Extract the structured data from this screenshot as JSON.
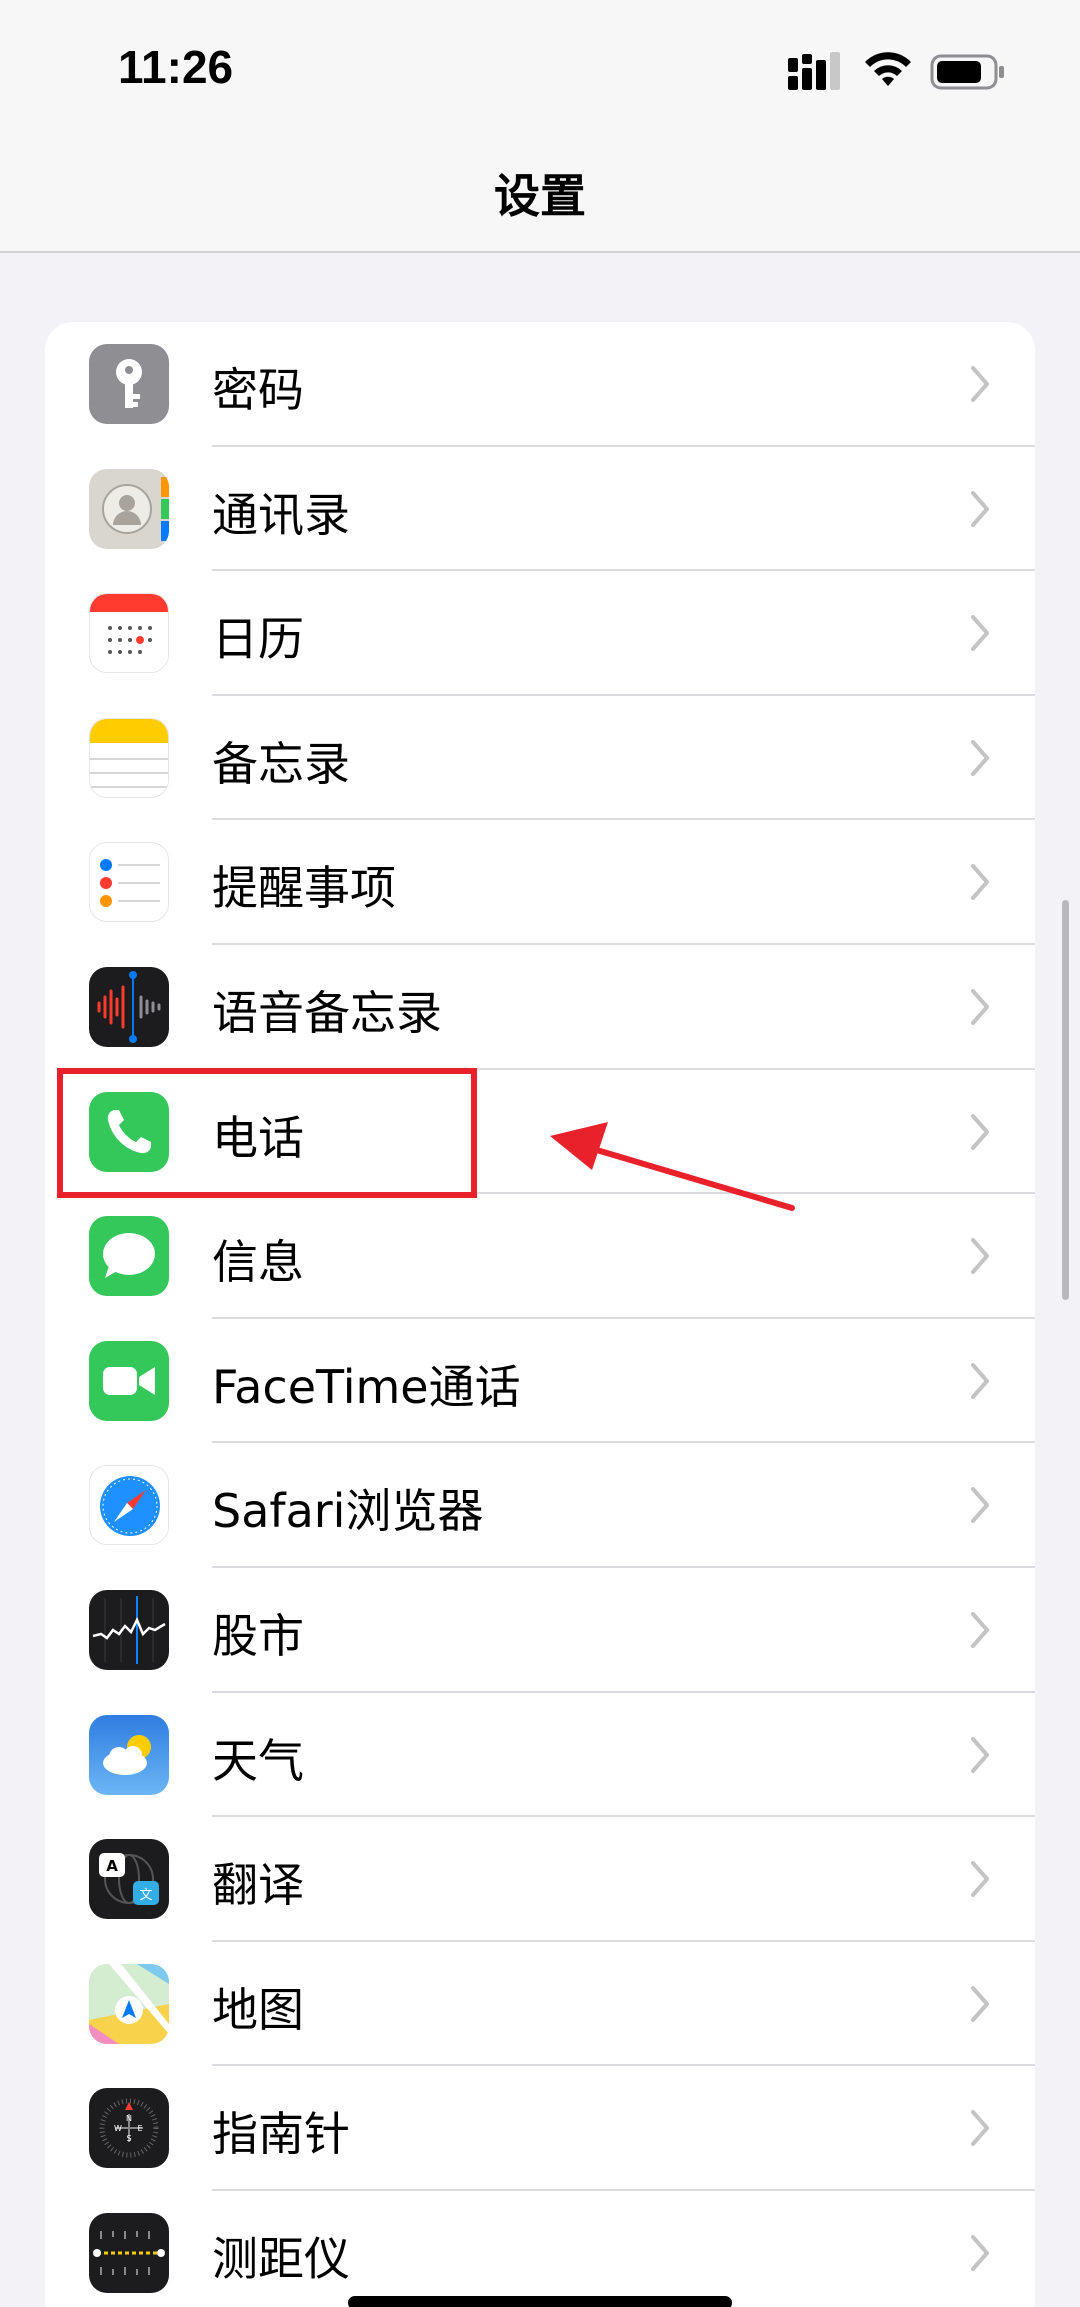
{
  "status_bar": {
    "time": "11:26"
  },
  "header": {
    "title": "设置"
  },
  "settings_items": [
    {
      "label": "密码",
      "icon": "key-icon"
    },
    {
      "label": "通讯录",
      "icon": "contacts-icon"
    },
    {
      "label": "日历",
      "icon": "calendar-icon"
    },
    {
      "label": "备忘录",
      "icon": "notes-icon"
    },
    {
      "label": "提醒事项",
      "icon": "reminders-icon"
    },
    {
      "label": "语音备忘录",
      "icon": "voice-memos-icon"
    },
    {
      "label": "电话",
      "icon": "phone-icon"
    },
    {
      "label": "信息",
      "icon": "messages-icon"
    },
    {
      "label": "FaceTime通话",
      "icon": "facetime-icon"
    },
    {
      "label": "Safari浏览器",
      "icon": "safari-icon"
    },
    {
      "label": "股市",
      "icon": "stocks-icon"
    },
    {
      "label": "天气",
      "icon": "weather-icon"
    },
    {
      "label": "翻译",
      "icon": "translate-icon"
    },
    {
      "label": "地图",
      "icon": "maps-icon"
    },
    {
      "label": "指南针",
      "icon": "compass-icon"
    },
    {
      "label": "测距仪",
      "icon": "measure-icon"
    }
  ],
  "colors": {
    "annotation": "#e8212b",
    "phone_green": "#34c759",
    "chevron": "#c4c4c7"
  }
}
